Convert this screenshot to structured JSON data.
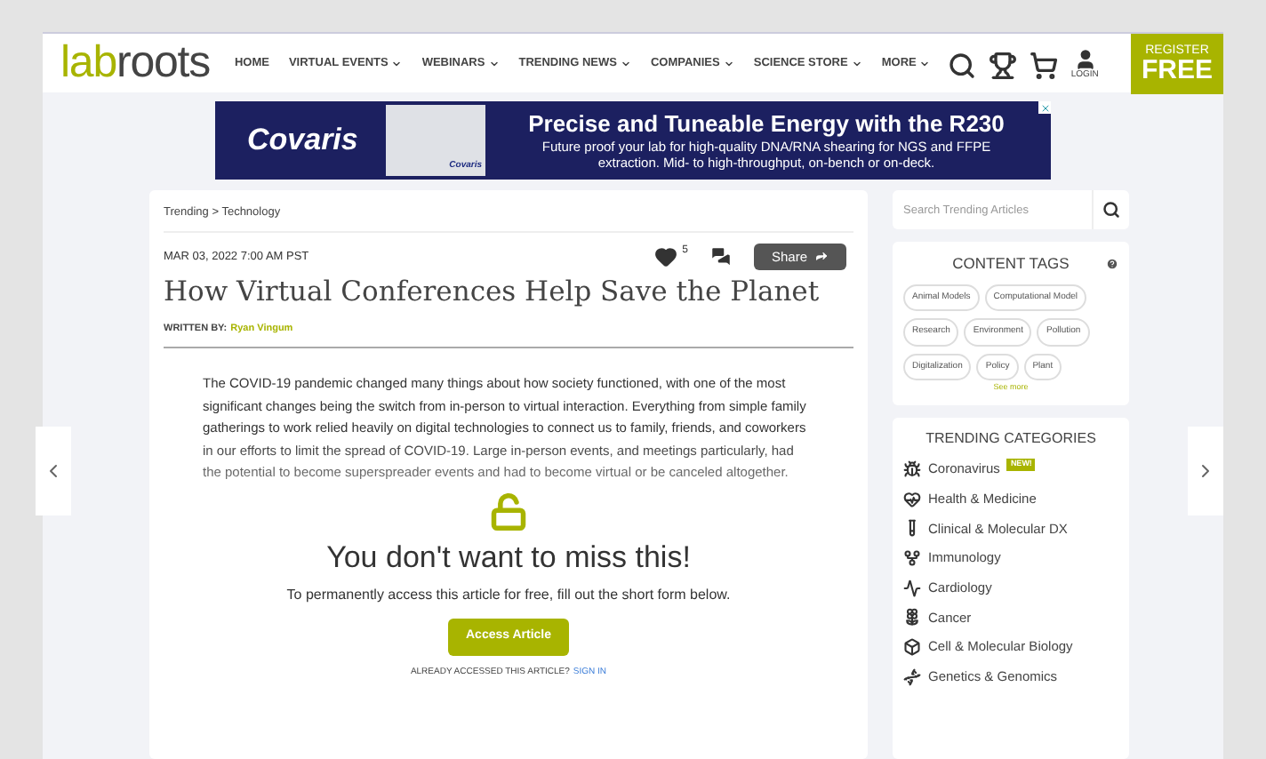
{
  "header": {
    "logo": {
      "part_1": "lab",
      "part_2": "roots"
    },
    "nav": [
      {
        "label": "HOME",
        "has_dropdown": false
      },
      {
        "label": "VIRTUAL EVENTS",
        "has_dropdown": true
      },
      {
        "label": "WEBINARS",
        "has_dropdown": true
      },
      {
        "label": "TRENDING NEWS",
        "has_dropdown": true
      },
      {
        "label": "COMPANIES",
        "has_dropdown": true
      },
      {
        "label": "SCIENCE STORE",
        "has_dropdown": true
      },
      {
        "label": "MORE",
        "has_dropdown": true
      }
    ],
    "login_label": "LOGIN",
    "register": {
      "line_1": "REGISTER",
      "line_2": "FREE"
    }
  },
  "ad": {
    "brand": "Covaris",
    "product_label": "Covaris",
    "headline": "Precise and Tuneable Energy with the R230",
    "body": "Future proof your lab for high-quality DNA/RNA shearing for NGS and FFPE extraction. Mid- to high-throughput, on-bench or on-deck."
  },
  "article": {
    "breadcrumb": "Trending > Technology",
    "date": "MAR 03, 2022 7:00 AM PST",
    "likes": "5",
    "share": "Share",
    "title": "How Virtual Conferences Help Save the Planet",
    "byline_label": "WRITTEN BY:",
    "author": "Ryan Vingum",
    "body": "The COVID-19 pandemic changed many things about how society functioned, with one of the most significant changes being the switch from in-person to virtual interaction. Everything from simple family gatherings to work relied heavily on digital technologies to connect us to family, friends, and coworkers in our efforts to limit the spread of COVID-19. Large in-person events, and meetings particularly, had the potential to become superspreader events and had to become virtual or be canceled altogether.",
    "gate_title": "You don't want to miss this!",
    "gate_text": "To permanently access this article for free, fill out the short form below.",
    "gate_button": "Access Article",
    "already": "ALREADY ACCESSED THIS ARTICLE?",
    "sign_in": "SIGN IN"
  },
  "sidebar": {
    "search": {
      "placeholder": "Search Trending Articles"
    },
    "content_tags": {
      "title": "CONTENT TAGS",
      "tags": [
        "Animal Models",
        "Computational Model",
        "Research",
        "Environment",
        "Pollution",
        "Digitalization",
        "Policy",
        "Plant"
      ],
      "see_more": "See more"
    },
    "trending": {
      "title": "TRENDING CATEGORIES",
      "items": [
        {
          "label": "Coronavirus",
          "badge": "NEW!"
        },
        {
          "label": "Health & Medicine"
        },
        {
          "label": "Clinical & Molecular DX"
        },
        {
          "label": "Immunology"
        },
        {
          "label": "Cardiology"
        },
        {
          "label": "Cancer"
        },
        {
          "label": "Cell & Molecular Biology"
        },
        {
          "label": "Genetics & Genomics"
        }
      ]
    }
  }
}
